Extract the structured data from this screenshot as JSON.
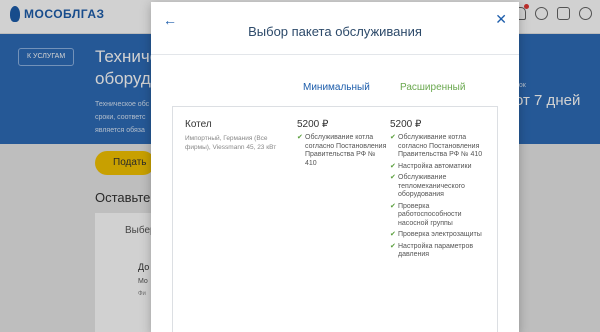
{
  "header": {
    "logo": "МОСОБЛГАЗ"
  },
  "hero": {
    "back_chip": "К УСЛУГАМ",
    "title_line1": "Техниче",
    "title_line2": "оборудо",
    "text_lines": [
      "Техническое обс",
      "сроки, соответс",
      "является обяза"
    ],
    "right_small": "рок",
    "right_big": "от 7 дней"
  },
  "background": {
    "button_label": "Подать",
    "heading": "Оставьте",
    "card_label": "Выбер",
    "card_sub": "До",
    "card_sub2": "Мо",
    "card_sub3": "Фи"
  },
  "modal": {
    "title": "Выбор пакета обслуживания",
    "back_icon": "arrow-left-icon",
    "close_icon": "close-icon",
    "columns": [
      "Минимальный",
      "Расширенный"
    ],
    "row": {
      "name": "Котел",
      "desc": "Импортный, Германия (Все фирмы), Viessmann 45, 23 кВт",
      "minimal": {
        "price": "5200 ₽",
        "features": [
          "Обслуживание котла согласно Постановления Правительства РФ № 410"
        ]
      },
      "extended": {
        "price": "5200 ₽",
        "features": [
          "Обслуживание котла согласно Постановления Правительства РФ № 410",
          "Настройка автоматики",
          "Обслуживание тепломеханического оборудования",
          "Проверка работоспособности насосной группы",
          "Проверка электрозащиты",
          "Настройка параметров давления"
        ]
      }
    }
  },
  "colors": {
    "brand_blue": "#1d5dab",
    "extended_green": "#6aa84f",
    "check_green": "#5a9e3c",
    "accent_yellow": "#f5c400"
  }
}
